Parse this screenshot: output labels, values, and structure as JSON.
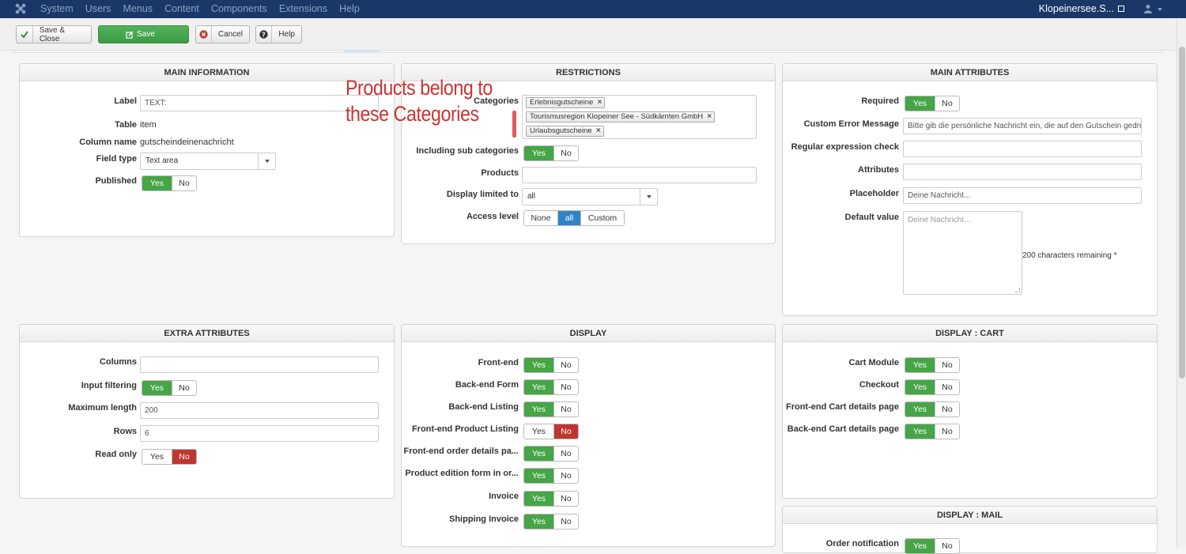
{
  "topbar": {
    "menu": [
      "System",
      "Users",
      "Menus",
      "Content",
      "Components",
      "Extensions",
      "Help"
    ],
    "site_name": "Klopeinersee.S..."
  },
  "toolbar": {
    "save_close": "Save & Close",
    "save": "Save",
    "cancel": "Cancel",
    "help": "Help"
  },
  "annotation": {
    "line1": "Products belong to",
    "line2": "these Categories"
  },
  "main_information": {
    "title": "MAIN INFORMATION",
    "label_label": "Label",
    "label_value": "TEXT:",
    "table_label": "Table",
    "table_value": "item",
    "column_label": "Column name",
    "column_value": "gutscheindeinenachricht",
    "fieldtype_label": "Field type",
    "fieldtype_value": "Text area",
    "published_label": "Published",
    "yes": "Yes",
    "no": "No"
  },
  "restrictions": {
    "title": "RESTRICTIONS",
    "categories_label": "Categories",
    "categories": [
      "Erlebnisgutscheine",
      "Tourismusregion Klopeiner See - Südkärnten GmbH",
      "Urlaubsgutscheine"
    ],
    "sub_label": "Including sub categories",
    "products_label": "Products",
    "display_limited_label": "Display limited to",
    "display_limited_value": "all",
    "access_label": "Access level",
    "access_options": [
      "None",
      "all",
      "Custom"
    ],
    "yes": "Yes",
    "no": "No"
  },
  "main_attributes": {
    "title": "MAIN ATTRIBUTES",
    "required_label": "Required",
    "error_label": "Custom Error Message",
    "error_value": "Bitte gib die persönliche Nachricht ein, die auf den Gutschein gedruckt werden soll.",
    "regex_label": "Regular expression check",
    "attributes_label": "Attributes",
    "placeholder_label": "Placeholder",
    "placeholder_value": "Deine Nachricht...",
    "default_label": "Default value",
    "default_placeholder": "Deine Nachricht...",
    "remaining": "200 characters remaining *",
    "yes": "Yes",
    "no": "No"
  },
  "extra_attributes": {
    "title": "EXTRA ATTRIBUTES",
    "columns_label": "Columns",
    "filter_label": "Input filtering",
    "maxlen_label": "Maximum length",
    "maxlen_value": "200",
    "rows_label": "Rows",
    "rows_value": "6",
    "readonly_label": "Read only",
    "yes": "Yes",
    "no": "No"
  },
  "display": {
    "title": "DISPLAY",
    "rows": [
      "Front-end",
      "Back-end Form",
      "Back-end Listing",
      "Front-end Product Listing",
      "Front-end order details pa...",
      "Product edition form in or...",
      "Invoice",
      "Shipping Invoice"
    ],
    "yes": "Yes",
    "no": "No"
  },
  "display_cart": {
    "title": "DISPLAY : CART",
    "rows": [
      "Cart Module",
      "Checkout",
      "Front-end Cart details page",
      "Back-end Cart details page"
    ],
    "yes": "Yes",
    "no": "No"
  },
  "display_mail": {
    "title": "DISPLAY : MAIL",
    "rows": [
      "Order notification"
    ],
    "yes": "Yes",
    "no": "No"
  }
}
